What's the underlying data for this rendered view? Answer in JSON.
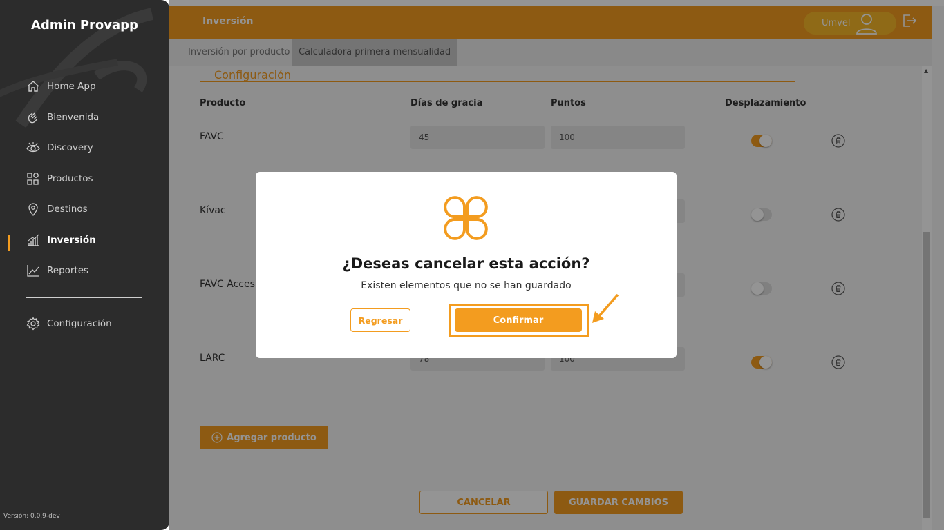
{
  "app": {
    "title": "Admin Provapp",
    "version": "Versión: 0.0.9-dev"
  },
  "sidebar": {
    "items": [
      {
        "label": "Home App",
        "icon": "home-icon"
      },
      {
        "label": "Bienvenida",
        "icon": "wave-hand-icon"
      },
      {
        "label": "Discovery",
        "icon": "eye-icon"
      },
      {
        "label": "Productos",
        "icon": "grid-icon"
      },
      {
        "label": "Destinos",
        "icon": "location-pin-icon"
      },
      {
        "label": "Inversión",
        "icon": "bar-chart-icon",
        "active": true
      },
      {
        "label": "Reportes",
        "icon": "line-chart-icon"
      },
      {
        "label": "Configuración",
        "icon": "gear-icon"
      }
    ]
  },
  "header": {
    "title": "Inversión",
    "user": "Umvel"
  },
  "tabs": [
    {
      "label": "Inversión por producto",
      "active": false
    },
    {
      "label": "Calculadora primera mensualidad",
      "active": true
    }
  ],
  "section": {
    "title": "Configuración"
  },
  "table": {
    "headers": {
      "product": "Producto",
      "grace": "Días de gracia",
      "points": "Puntos",
      "shift": "Desplazamiento"
    },
    "rows": [
      {
        "name": "FAVC",
        "grace": "45",
        "points": "100",
        "shift": true
      },
      {
        "name": "Kívac",
        "grace": "",
        "points": "",
        "shift": false
      },
      {
        "name": "FAVC Acces",
        "grace": "",
        "points": "",
        "shift": false
      },
      {
        "name": "LARC",
        "grace": "78",
        "points": "100",
        "shift": true
      }
    ]
  },
  "actions": {
    "add": "Agregar producto",
    "cancel": "CANCELAR",
    "save": "GUARDAR CAMBIOS"
  },
  "modal": {
    "title": "¿Deseas cancelar esta acción?",
    "subtitle": "Existen elementos que no se han guardado",
    "back": "Regresar",
    "confirm": "Confirmar"
  },
  "colors": {
    "accent": "#f39c1f",
    "sidebar": "#2c2c2c",
    "pill": "#f7b728"
  }
}
